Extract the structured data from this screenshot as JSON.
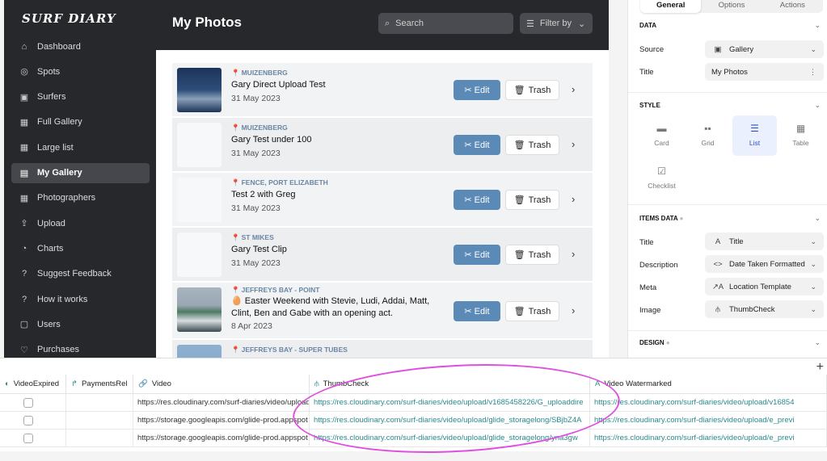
{
  "app": {
    "logo": "SURF DIARY",
    "page_title": "My Photos",
    "search_placeholder": "Search",
    "filter_label": "Filter by"
  },
  "sidebar": {
    "items": [
      {
        "label": "Dashboard",
        "icon": "⌂"
      },
      {
        "label": "Spots",
        "icon": "◎"
      },
      {
        "label": "Surfers",
        "icon": "▣"
      },
      {
        "label": "Full Gallery",
        "icon": "▦"
      },
      {
        "label": "Large list",
        "icon": "▦"
      },
      {
        "label": "My Gallery",
        "icon": "▤"
      },
      {
        "label": "Photographers",
        "icon": "▦"
      },
      {
        "label": "Upload",
        "icon": "⇪"
      },
      {
        "label": "Charts",
        "icon": "◔"
      },
      {
        "label": "Suggest Feedback",
        "icon": "?"
      },
      {
        "label": "How it works",
        "icon": "?"
      },
      {
        "label": "Users",
        "icon": "▢"
      },
      {
        "label": "Purchases",
        "icon": "♡"
      }
    ],
    "selected": "My Gallery"
  },
  "list": {
    "edit_label": "Edit",
    "trash_label": "Trash",
    "items": [
      {
        "location": "MUIZENBERG",
        "title": "Gary Direct Upload Test",
        "date": "31 May 2023"
      },
      {
        "location": "MUIZENBERG",
        "title": "Gary Test under 100",
        "date": "31 May 2023"
      },
      {
        "location": "FENCE, PORT ELIZABETH",
        "title": "Test 2 with Greg",
        "date": "31 May 2023"
      },
      {
        "location": "ST MIKES",
        "title": "Gary Test Clip",
        "date": "31 May 2023"
      },
      {
        "location": "JEFFREYS BAY - POINT",
        "title": "🥚 Easter Weekend with Stevie, Ludi, Addai, Matt, Clint, Ben and Gabe with an opening act.",
        "date": "8 Apr 2023"
      },
      {
        "location": "JEFFREYS BAY - SUPER TUBES"
      }
    ]
  },
  "panel": {
    "tabs": [
      "General",
      "Options",
      "Actions"
    ],
    "active_tab": "General",
    "data_section": "DATA",
    "source_label": "Source",
    "source_value": "Gallery",
    "title_label": "Title",
    "title_value": "My Photos",
    "style_section": "STYLE",
    "styles": [
      "Card",
      "Grid",
      "List",
      "Table",
      "Checklist"
    ],
    "active_style": "List",
    "items_section": "ITEMS DATA",
    "items": [
      {
        "label": "Title",
        "value": "Title",
        "icon": "A"
      },
      {
        "label": "Description",
        "value": "Date Taken Formatted",
        "icon": "<>"
      },
      {
        "label": "Meta",
        "value": "Location Template",
        "icon": "↗A"
      },
      {
        "label": "Image",
        "value": "ThumbCheck",
        "icon": "⫛"
      }
    ],
    "design_section": "DESIGN"
  },
  "grid": {
    "columns": [
      "VideoExpired",
      "PaymentsRel",
      "Video",
      "ThumbCheck",
      "Video Watermarked"
    ],
    "rows": [
      {
        "video": "https://res.cloudinary.com/surf-diaries/video/upload",
        "thumb": "https://res.cloudinary.com/surf-diaries/video/upload/v1685458226/G_uploaddire",
        "wm": "https://res.cloudinary.com/surf-diaries/video/upload/v16854"
      },
      {
        "video": "https://storage.googleapis.com/glide-prod.appspot",
        "thumb": "https://res.cloudinary.com/surf-diaries/video/upload/glide_storagelong/SBjbZ4A",
        "wm": "https://res.cloudinary.com/surf-diaries/video/upload/e_previ"
      },
      {
        "video": "https://storage.googleapis.com/glide-prod.appspot",
        "thumb": "https://res.cloudinary.com/surf-diaries/video/upload/glide_storagelong/yna3gw",
        "wm": "https://res.cloudinary.com/surf-diaries/video/upload/e_previ"
      }
    ]
  },
  "colors": {
    "sidebar": "#27282c",
    "accent": "#5b8ab6",
    "link": "#2a8a8a",
    "annotation": "#e04ee0"
  }
}
